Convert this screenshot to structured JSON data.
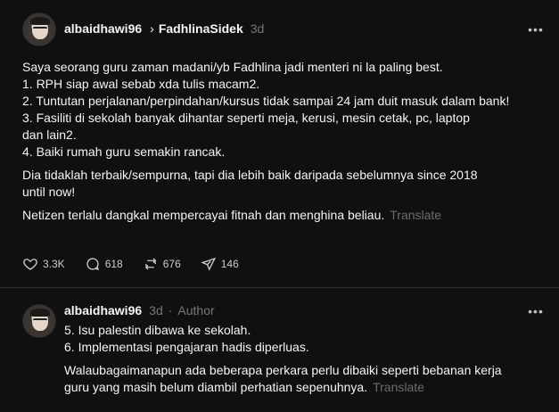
{
  "post": {
    "username": "albaidhawi96",
    "reply_to": "FadhlinaSidek",
    "time": "3d",
    "more_label": "•••",
    "paragraphs": [
      [
        "Saya seorang guru zaman madani/yb Fadhlina jadi menteri ni la paling best.",
        "1. RPH siap awal sebab xda tulis macam2.",
        "2. Tuntutan perjalanan/perpindahan/kursus tidak sampai 24 jam duit masuk dalam bank!",
        "3. Fasiliti di sekolah banyak dihantar seperti meja, kerusi, mesin cetak, pc, laptop",
        "dan lain2.",
        "4. Baiki rumah guru semakin rancak."
      ],
      [
        "Dia tidaklah terbaik/sempurna, tapi dia lebih baik daripada sebelumnya since 2018",
        "until now!"
      ],
      [
        "Netizen terlalu dangkal mempercayai fitnah dan menghina beliau."
      ]
    ],
    "translate": "Translate",
    "likes": "3.3K",
    "replies": "618",
    "reposts": "676",
    "shares": "146"
  },
  "reply": {
    "username": "albaidhawi96",
    "time": "3d",
    "dot": "·",
    "author": "Author",
    "more_label": "•••",
    "paragraphs": [
      [
        "5. Isu palestin dibawa ke sekolah.",
        "6. Implementasi pengajaran hadis diperluas."
      ],
      [
        "Walaubagaimanapun ada beberapa perkara perlu dibaiki seperti bebanan kerja",
        "guru yang masih belum diambil perhatian sepenuhnya."
      ]
    ],
    "translate": "Translate"
  },
  "icons": {
    "like": "heart-icon",
    "reply": "comment-icon",
    "repost": "repost-icon",
    "share": "send-icon",
    "chevron": "chevron-right-icon",
    "more": "more-options-icon"
  }
}
